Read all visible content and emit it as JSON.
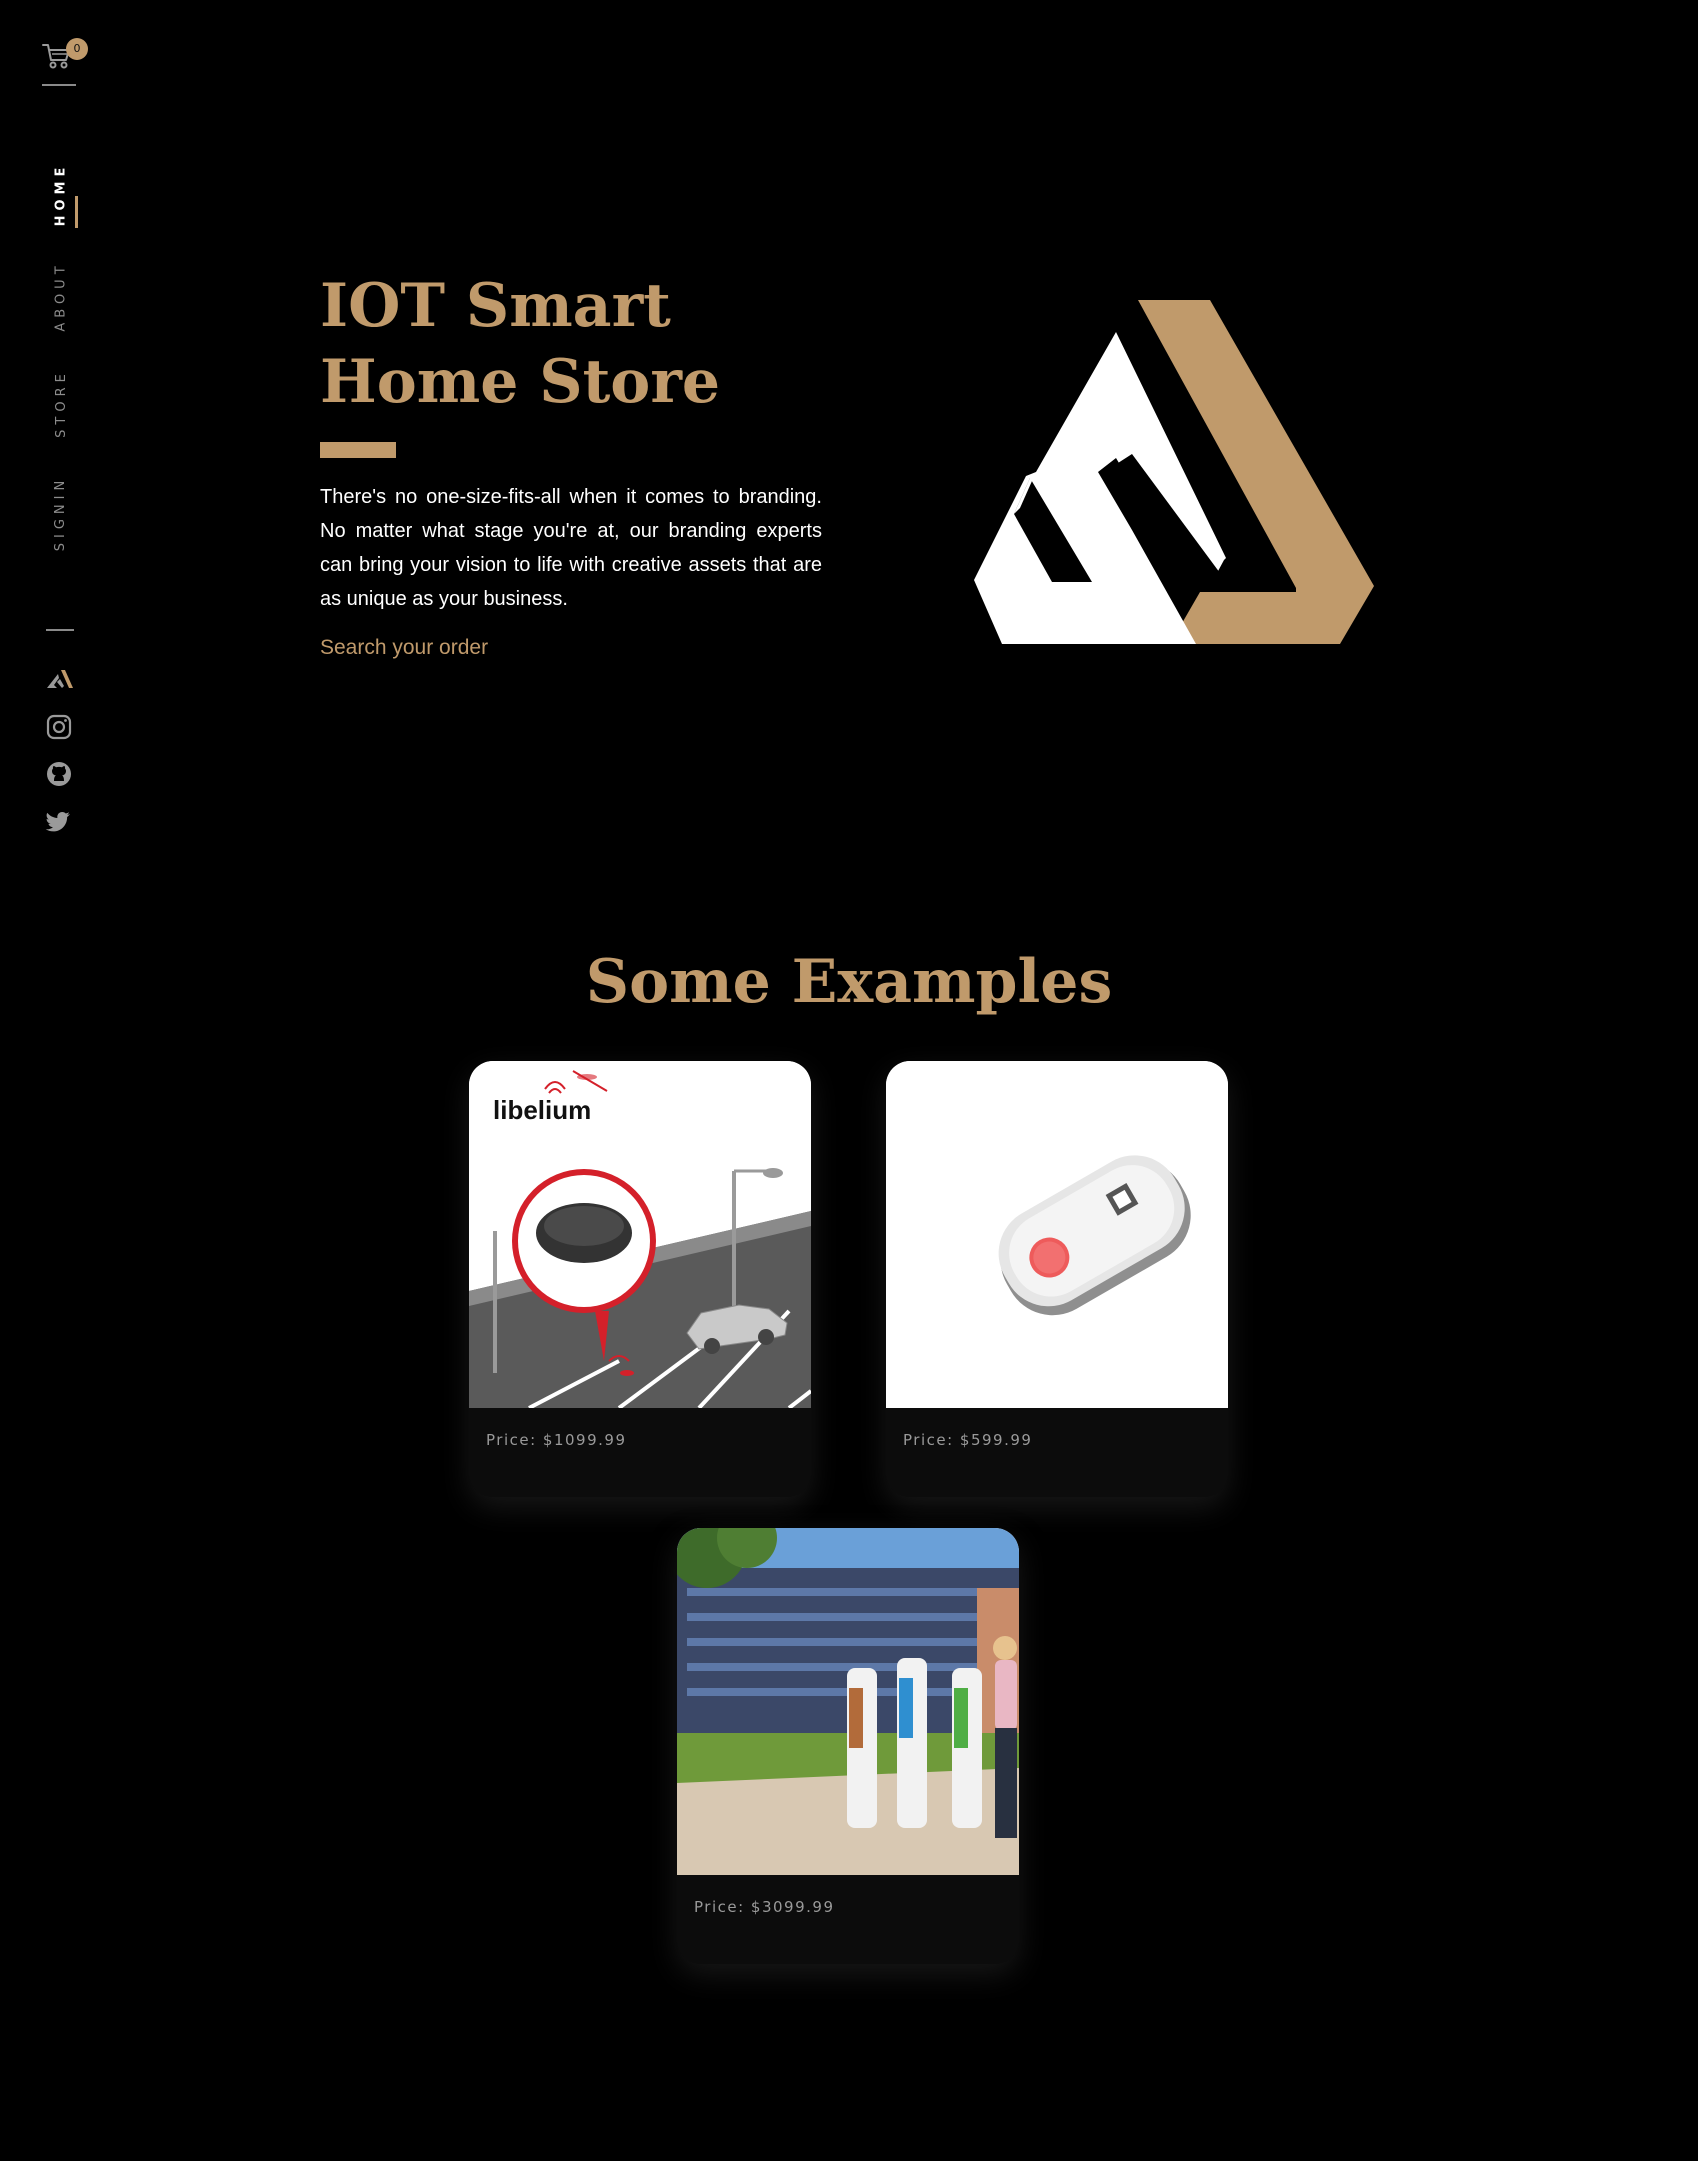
{
  "cart": {
    "icon": "cart-icon",
    "count": "0"
  },
  "nav": {
    "items": [
      {
        "label": "HOME",
        "active": true
      },
      {
        "label": "ABOUT",
        "active": false
      },
      {
        "label": "STORE",
        "active": false
      },
      {
        "label": "SIGNIN",
        "active": false
      }
    ]
  },
  "social": [
    "brand-logo-icon",
    "instagram-icon",
    "github-icon",
    "twitter-icon"
  ],
  "hero": {
    "title_line1": "IOT Smart",
    "title_line2": "Home Store",
    "description": "There's no one-size-fits-all when it comes to branding. No matter what stage you're at, our branding experts can bring your vision to life with creative assets that are as unique as your business.",
    "link": "Search your order"
  },
  "examples": {
    "title": "Some Examples",
    "cards": [
      {
        "image": "libelium-parking-sensor",
        "logo_text": "libelium",
        "price": "Price: $1099.99"
      },
      {
        "image": "white-sensor-device",
        "price": "Price: $599.99"
      },
      {
        "image": "charging-stations-street",
        "price": "Price: $3099.99"
      }
    ]
  },
  "colors": {
    "background": "#000000",
    "accent": "#c09a6b",
    "text": "#ffffff",
    "muted": "#8c8c8c"
  }
}
